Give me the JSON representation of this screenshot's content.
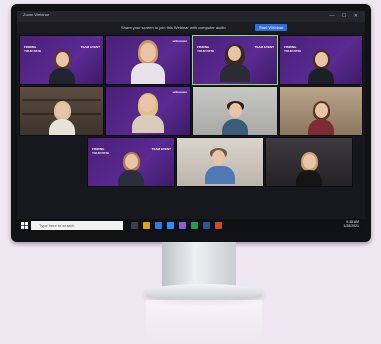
{
  "window": {
    "title": "Zoom Webinar",
    "controls": "— ☐ ✕"
  },
  "notice": {
    "text": "Share your screen to join this Webinar with computer audio",
    "button_label": "Start Webinar"
  },
  "tiles": {
    "t1": {
      "banner_left": "FINDING YOUR PATH",
      "banner_right": "TEAM EVENT",
      "logo": "",
      "name": ""
    },
    "t2": {
      "banner_left": "",
      "banner_right": "",
      "logo": "unbounce",
      "name": ""
    },
    "t3": {
      "banner_left": "FINDING YOUR PATH",
      "banner_right": "TEAM EVENT",
      "logo": "",
      "name": ""
    },
    "t4": {
      "banner_left": "FINDING YOUR PATH",
      "banner_right": "",
      "logo": "",
      "name": ""
    },
    "t5": {
      "banner_left": "",
      "banner_right": "",
      "logo": "",
      "name": ""
    },
    "t6": {
      "banner_left": "",
      "banner_right": "",
      "logo": "unbounce",
      "name": ""
    },
    "t7": {
      "banner_left": "",
      "banner_right": "",
      "logo": "",
      "name": ""
    },
    "t8": {
      "banner_left": "",
      "banner_right": "",
      "logo": "",
      "name": ""
    },
    "t9": {
      "banner_left": "FINDING YOUR PATH",
      "banner_right": "TEAM EVENT",
      "logo": "",
      "name": ""
    },
    "t10": {
      "banner_left": "",
      "banner_right": "",
      "logo": "",
      "name": ""
    },
    "t11": {
      "banner_left": "",
      "banner_right": "",
      "logo": "",
      "name": ""
    }
  },
  "taskbar": {
    "search_placeholder": "Type here to search",
    "time": "9:48 AM",
    "date": "1/28/2021"
  },
  "colors": {
    "active_speaker": "#8fe068",
    "webinar_purple": "#5b2a92",
    "button_blue": "#2f6fe4"
  }
}
